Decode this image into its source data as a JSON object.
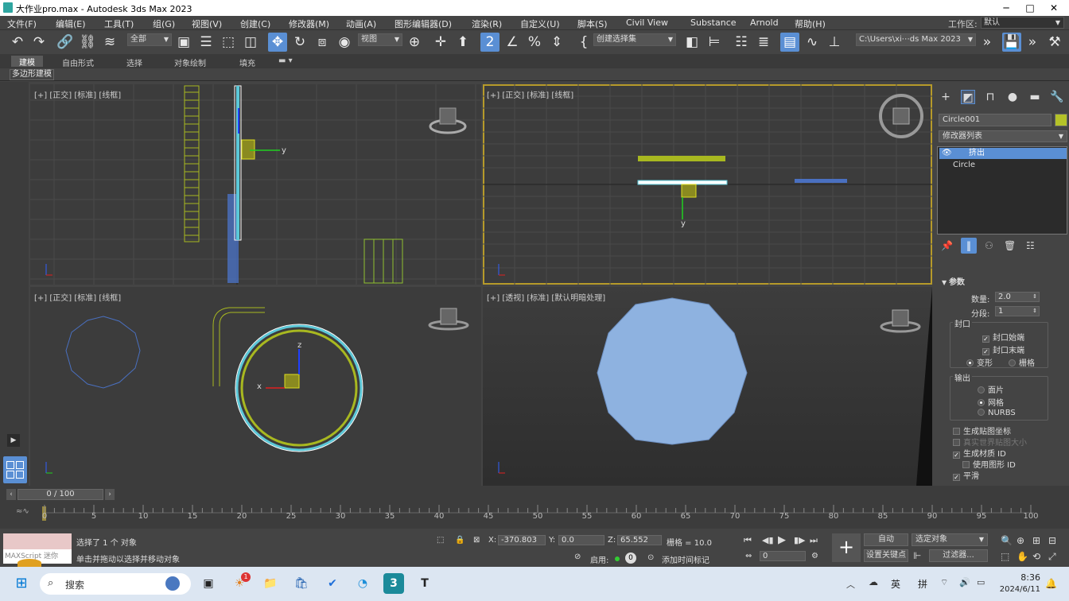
{
  "window": {
    "title": "大作业pro.max - Autodesk 3ds Max 2023",
    "minimize": "─",
    "maximize": "□",
    "close": "✕"
  },
  "menu": [
    "文件(F)",
    "编辑(E)",
    "工具(T)",
    "组(G)",
    "视图(V)",
    "创建(C)",
    "修改器(M)",
    "动画(A)",
    "图形编辑器(D)",
    "渲染(R)",
    "自定义(U)",
    "脚本(S)",
    "Civil View",
    "Substance",
    "Arnold",
    "帮助(H)"
  ],
  "workspace": {
    "label": "工作区:",
    "value": "默认"
  },
  "toolbar": {
    "selection_filter": "全部",
    "ref_coord": "视图",
    "named_selection": "创建选择集",
    "path": "C:\\Users\\xi⋯ds Max 2023"
  },
  "ribbon": {
    "tabs": [
      "建模",
      "自由形式",
      "选择",
      "对象绘制",
      "填充"
    ],
    "active": "建模",
    "panel": "多边形建模"
  },
  "viewports": {
    "top_left": {
      "label": "[+] [正交] [标准] [线框]"
    },
    "top_right": {
      "label": "[+] [正交] [标准] [线框]",
      "axis_y": "y"
    },
    "bottom_left": {
      "label": "[+] [正交] [标准] [线框]",
      "axis_x": "x",
      "axis_z": "z"
    },
    "bottom_right": {
      "label": "[+] [透视] [标准] [默认明暗处理]"
    },
    "axis_y": "y"
  },
  "command_panel": {
    "object_name": "Circle001",
    "object_color": "#b5c228",
    "modifier_list": "修改器列表",
    "stack": [
      "挤出",
      "Circle"
    ],
    "rollout": "参数",
    "amount_label": "数量:",
    "amount": "2.0",
    "segments_label": "分段:",
    "segments": "1",
    "capping": "封口",
    "cap_start": "封口始端",
    "cap_end": "封口末端",
    "morph": "变形",
    "grid": "栅格",
    "output": "输出",
    "patch": "面片",
    "mesh": "网格",
    "nurbs": "NURBS",
    "gen_map": "生成贴图坐标",
    "real_world": "真实世界贴图大小",
    "gen_mat": "生成材质 ID",
    "use_shape": "使用图形 ID",
    "smooth": "平滑"
  },
  "time": {
    "frame": "0 / 100",
    "ticks": [
      "0",
      "5",
      "10",
      "15",
      "20",
      "25",
      "30",
      "35",
      "40",
      "45",
      "50",
      "55",
      "60",
      "65",
      "70",
      "75",
      "80",
      "85",
      "90",
      "95",
      "100"
    ]
  },
  "status": {
    "maxscript": "MAXScript 迷你",
    "selected": "选择了 1 个 对象",
    "hint": "单击并拖动以选择并移动对象",
    "x": "-370.803",
    "y": "0.0",
    "z": "65.552",
    "grid": "栅格 = 10.0",
    "enable": "启用:",
    "enable_value": "0",
    "add_time_tag": "添加时间标记",
    "auto": "自动",
    "set_key": "设置关键点",
    "sel_obj": "选定对象",
    "filters": "过滤器...",
    "frame_field": "0"
  },
  "taskbar": {
    "search": "搜索",
    "badge": "1",
    "lang1": "英",
    "lang2": "拼",
    "time": "8:36",
    "date": "2024/6/11"
  }
}
